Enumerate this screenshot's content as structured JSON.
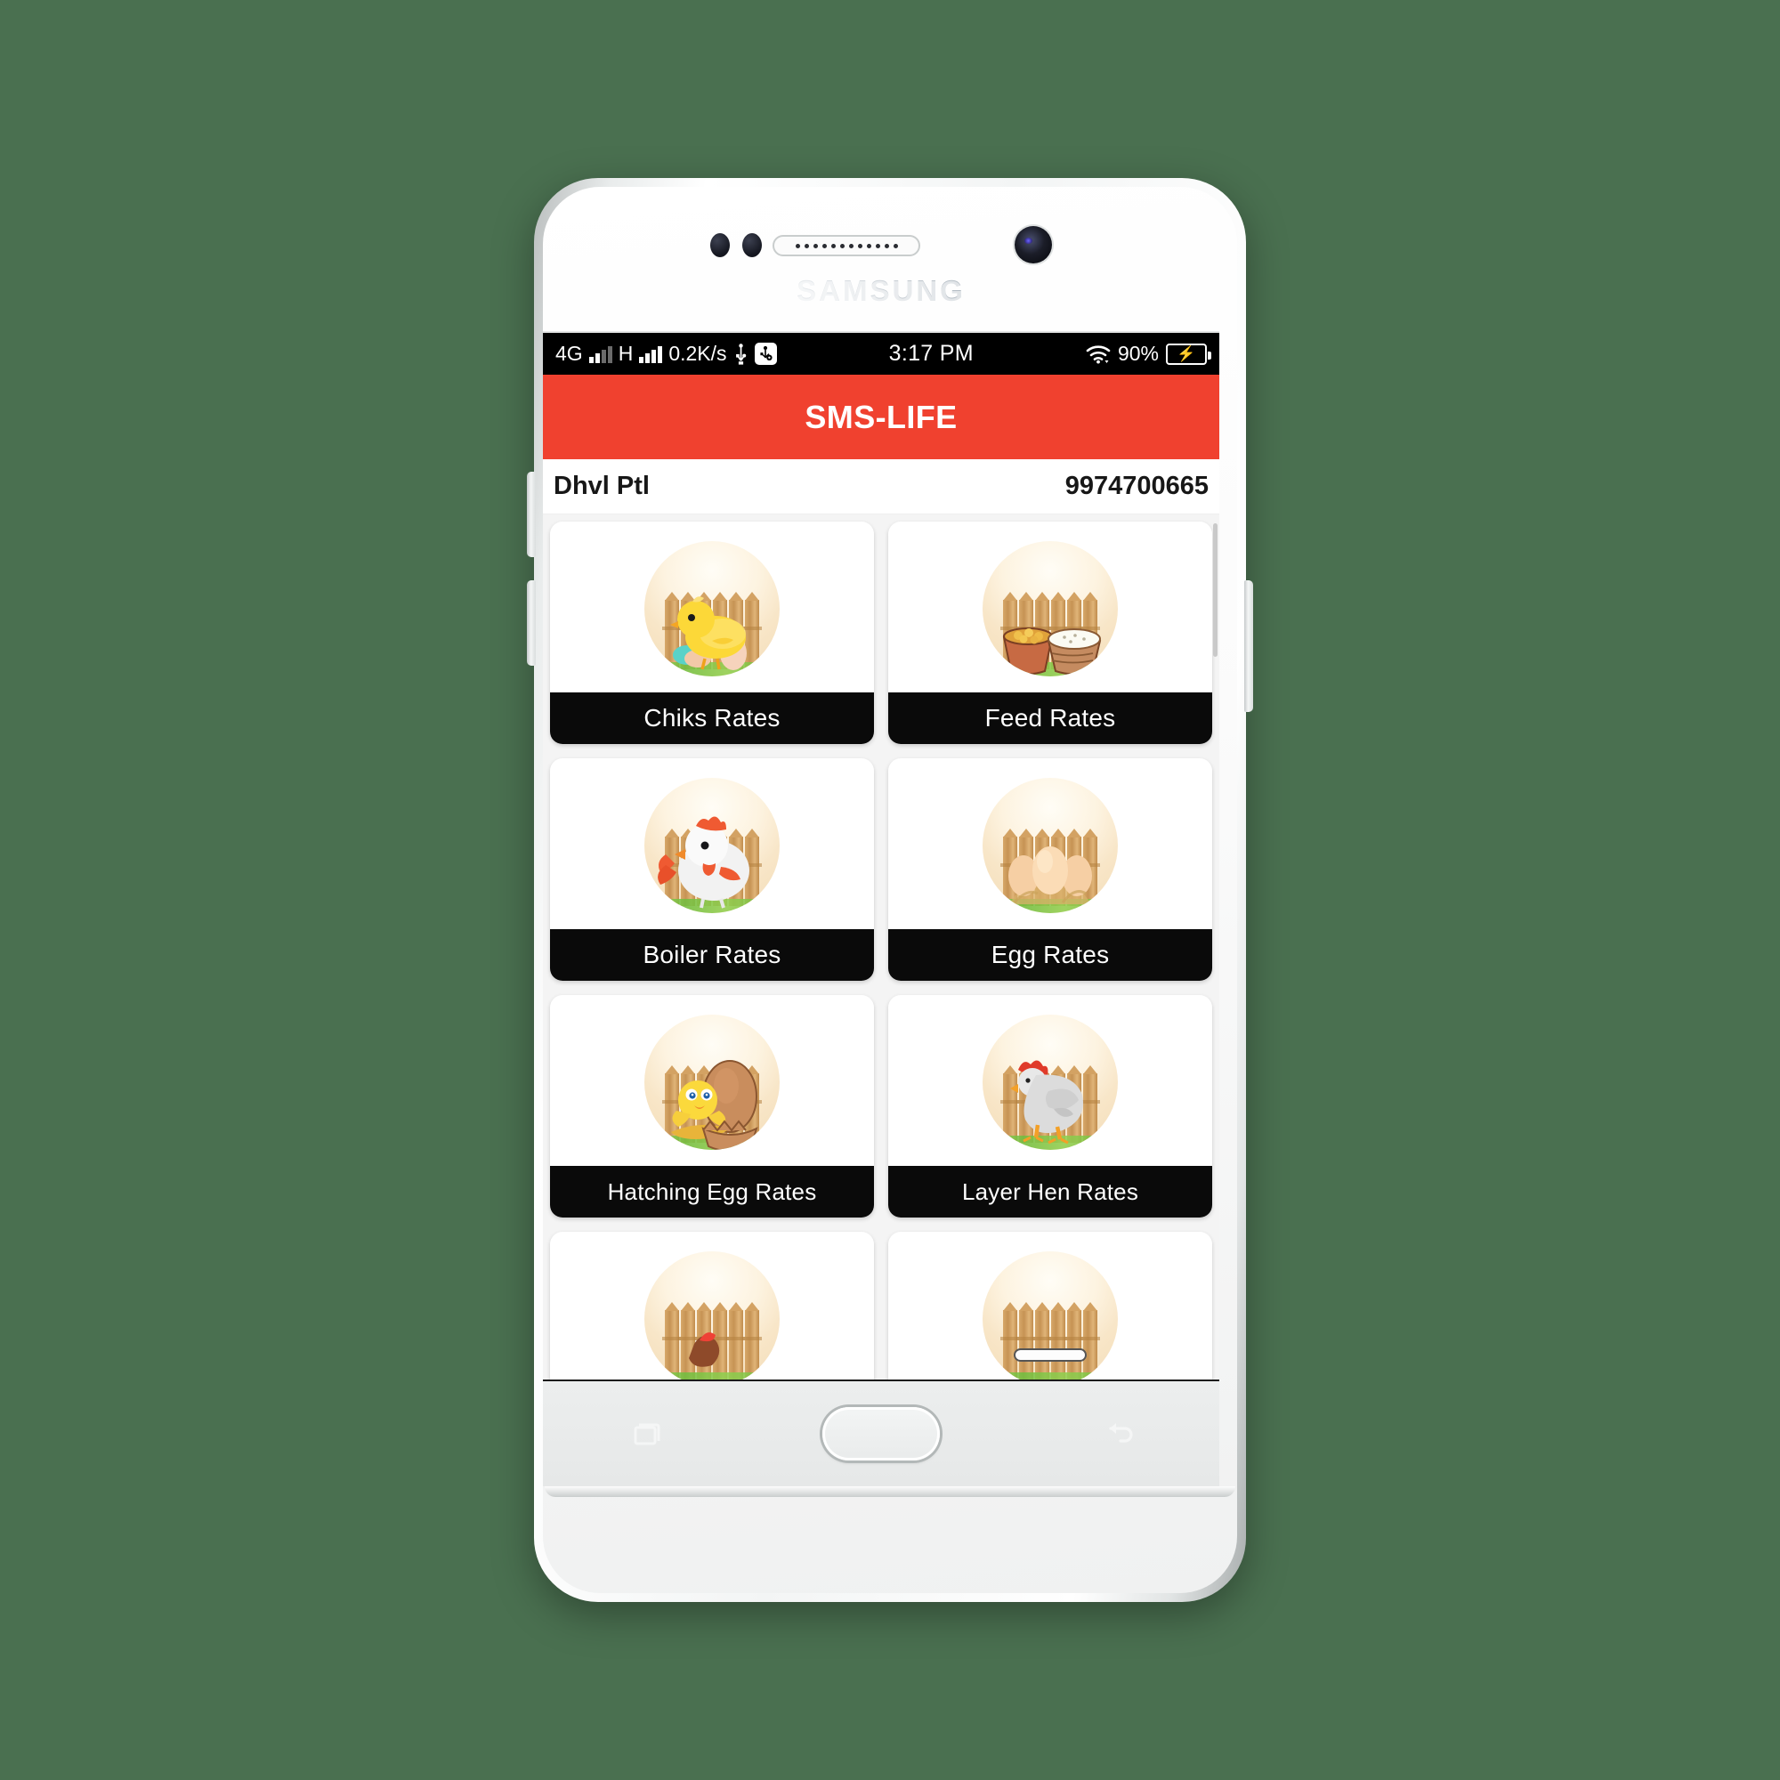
{
  "device": {
    "brand": "SAMSUNG",
    "icons": {
      "front_camera": "front-camera-icon",
      "earpiece": "earpiece-speaker",
      "proximity_sensor": "proximity-sensor-icon",
      "recents": "recents-icon",
      "home": "home-button",
      "back": "back-icon",
      "volume_up": "volume-up-button",
      "volume_down": "volume-down-button",
      "power": "power-button"
    }
  },
  "statusbar": {
    "network_type": "4G",
    "network_type2": "H",
    "data_speed": "0.2K/s",
    "usb_icon": "usb-icon",
    "usb_settings_icon": "usb-settings-icon",
    "signal_icon": "signal-bars-icon",
    "time": "3:17 PM",
    "wifi_icon": "wifi-icon",
    "battery_percent": "90%",
    "battery_icon": "battery-charging-icon"
  },
  "appbar": {
    "title": "SMS-LIFE",
    "color": "#f0412f"
  },
  "user": {
    "name": "Dhvl Ptl",
    "phone": "9974700665"
  },
  "grid": {
    "cards": [
      {
        "label": "Chiks Rates",
        "icon": "chick-icon"
      },
      {
        "label": "Feed Rates",
        "icon": "feed-baskets-icon"
      },
      {
        "label": "Boiler Rates",
        "icon": "white-hen-icon"
      },
      {
        "label": "Egg Rates",
        "icon": "eggs-icon"
      },
      {
        "label": "Hatching Egg Rates",
        "icon": "hatching-egg-icon"
      },
      {
        "label": "Layer Hen Rates",
        "icon": "layer-hen-icon"
      },
      {
        "label": "",
        "icon": "rooster-icon"
      },
      {
        "label": "",
        "icon": "fence-icon"
      }
    ]
  },
  "theme": {
    "background": "#4a7050",
    "accent_red": "#f0412f",
    "label_black": "#0a0a0a",
    "grid_bg": "#f4f4f4"
  }
}
